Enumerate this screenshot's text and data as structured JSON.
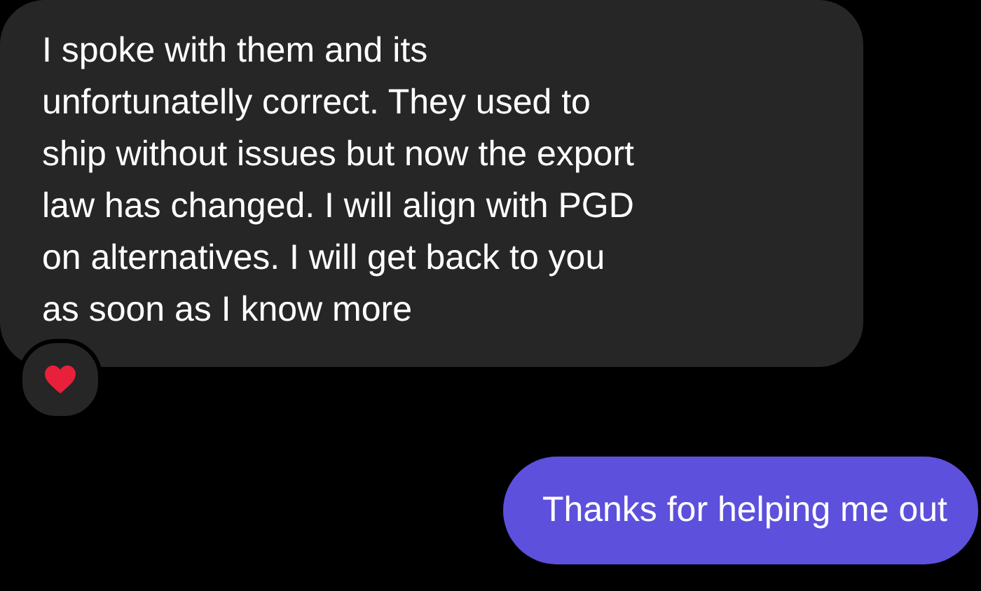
{
  "messages": [
    {
      "kind": "incoming",
      "text": "I spoke with them and its\nunfortunatelly correct. They used to\nship without issues but now the export\nlaw has changed. I will align with PGD\non alternatives. I will get back to you\nas soon as I know more",
      "reactions": [
        {
          "kind": "heart"
        }
      ]
    },
    {
      "kind": "outgoing",
      "text": "Thanks for helping me out"
    }
  ]
}
